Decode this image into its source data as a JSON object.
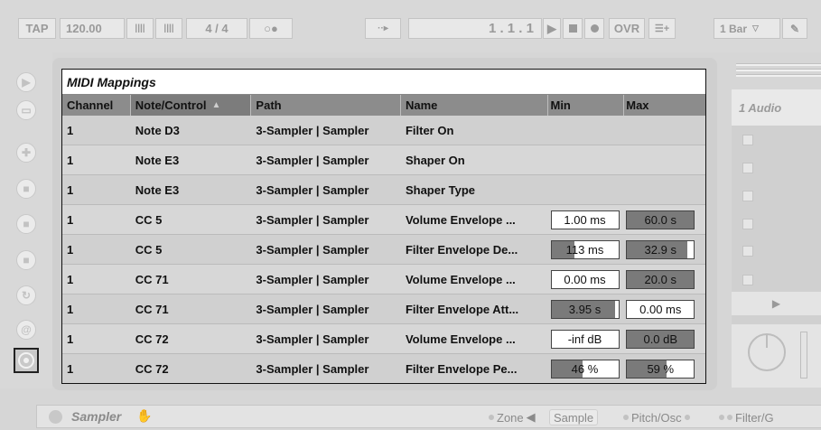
{
  "transport": {
    "tap": "TAP",
    "tempo": "120.00",
    "nudge_down_glyph": "||||",
    "nudge_up_glyph": "||||",
    "signature": "4 / 4",
    "metronome_glyph": "○●",
    "follow_glyph": "··▸",
    "position": "1 .  1 .  1",
    "ovr": "OVR",
    "loop_glyph": "☰+",
    "quantize": "1 Bar"
  },
  "mappings": {
    "title": "MIDI Mappings",
    "columns": [
      "Channel",
      "Note/Control",
      "Path",
      "Name",
      "Min",
      "Max"
    ],
    "sort_indicator": "▲",
    "rows": [
      {
        "channel": "1",
        "control": "Note D3",
        "path": "3-Sampler | Sampler",
        "name": "Filter On",
        "min": "",
        "max": "",
        "min_fill": 0,
        "max_fill": 0
      },
      {
        "channel": "1",
        "control": "Note E3",
        "path": "3-Sampler | Sampler",
        "name": "Shaper On",
        "min": "",
        "max": "",
        "min_fill": 0,
        "max_fill": 0
      },
      {
        "channel": "1",
        "control": "Note E3",
        "path": "3-Sampler | Sampler",
        "name": "Shaper Type",
        "min": "",
        "max": "",
        "min_fill": 0,
        "max_fill": 0
      },
      {
        "channel": "1",
        "control": "CC 5",
        "path": "3-Sampler | Sampler",
        "name": "Volume Envelope ...",
        "min": "1.00 ms",
        "max": "60.0 s",
        "min_fill": 0,
        "max_fill": 1
      },
      {
        "channel": "1",
        "control": "CC 5",
        "path": "3-Sampler | Sampler",
        "name": "Filter Envelope De...",
        "min": "113 ms",
        "max": "32.9 s",
        "min_fill": 0.35,
        "max_fill": 0.9
      },
      {
        "channel": "1",
        "control": "CC 71",
        "path": "3-Sampler | Sampler",
        "name": "Volume Envelope ...",
        "min": "0.00 ms",
        "max": "20.0 s",
        "min_fill": 0,
        "max_fill": 1
      },
      {
        "channel": "1",
        "control": "CC 71",
        "path": "3-Sampler | Sampler",
        "name": "Filter Envelope Att...",
        "min": "3.95 s",
        "max": "0.00 ms",
        "min_fill": 0.95,
        "max_fill": 0
      },
      {
        "channel": "1",
        "control": "CC 72",
        "path": "3-Sampler | Sampler",
        "name": "Volume Envelope ...",
        "min": "-inf dB",
        "max": "0.0 dB",
        "min_fill": 0,
        "max_fill": 1
      },
      {
        "channel": "1",
        "control": "CC 72",
        "path": "3-Sampler | Sampler",
        "name": "Filter Envelope Pe...",
        "min": "46 %",
        "max": "59 %",
        "min_fill": 0.46,
        "max_fill": 0.59
      }
    ]
  },
  "mixer": {
    "track_name": "1 Audio",
    "play_glyph": "▶"
  },
  "device": {
    "title": "Sampler",
    "tabs": [
      "Zone",
      "Sample",
      "Pitch/Osc",
      "Filter/G"
    ]
  }
}
